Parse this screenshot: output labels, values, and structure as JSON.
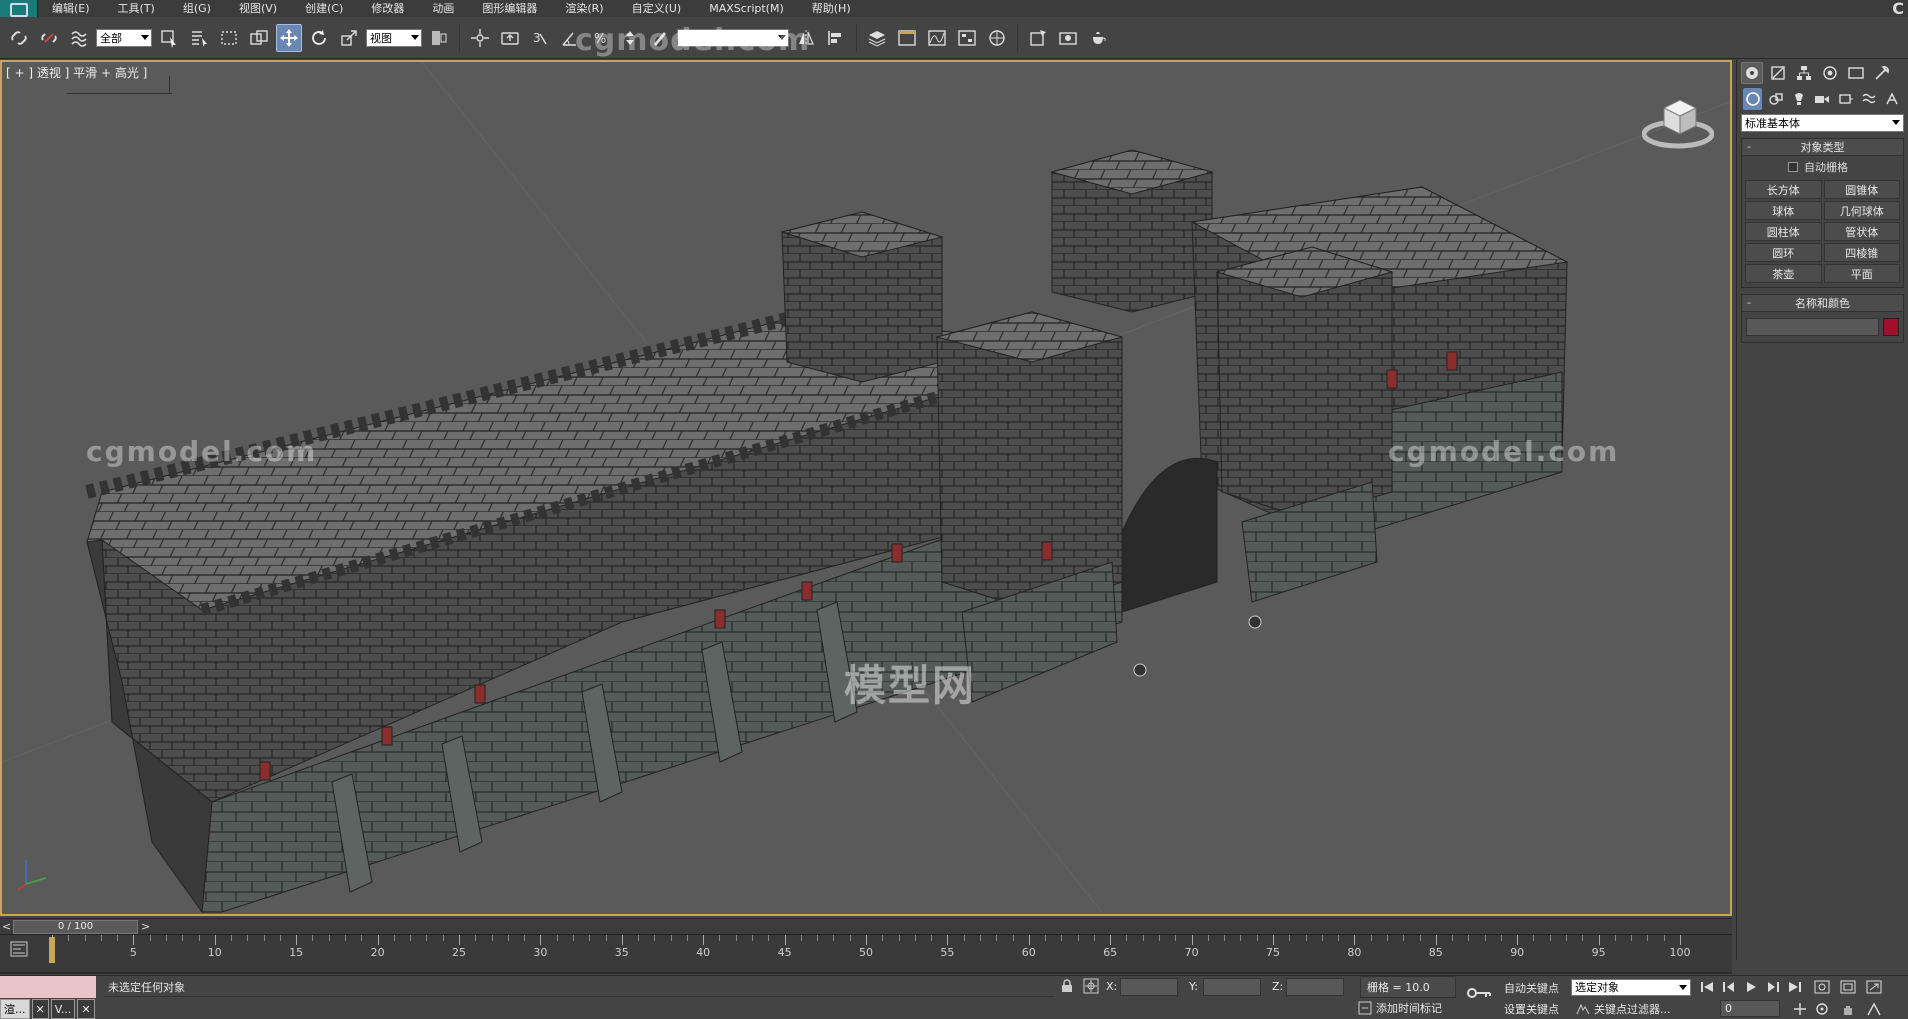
{
  "menubar": {
    "items": [
      "编辑(E)",
      "工具(T)",
      "组(G)",
      "视图(V)",
      "创建(C)",
      "修改器",
      "动画",
      "图形编辑器",
      "渲染(R)",
      "自定义(U)",
      "MAXScript(M)",
      "帮助(H)"
    ],
    "right_logo": "C"
  },
  "toolbar": {
    "selection_filter": "全部",
    "reference_coord": "视图",
    "watermark": "cgmodel.com",
    "active_tool": "move-tool"
  },
  "viewport": {
    "label": "[ + ] 透视 ] 平滑 + 高光 ]",
    "watermark_left": "cgmodel.com",
    "watermark_right": "cgmodel.com",
    "watermark_center": "模型网",
    "border_color": "#c7a55a",
    "background": "#5a5a5a"
  },
  "command_panel": {
    "category_dropdown": "标准基本体",
    "rollout_object_type": {
      "title": "对象类型",
      "autogrid_label": "自动栅格",
      "autogrid_checked": false,
      "buttons": [
        "长方体",
        "圆锥体",
        "球体",
        "几何球体",
        "圆柱体",
        "管状体",
        "圆环",
        "四棱锥",
        "茶壶",
        "平面"
      ]
    },
    "rollout_name_color": {
      "title": "名称和颜色",
      "name_value": "",
      "color": "#a0102c"
    }
  },
  "time_slider": {
    "label": "0 / 100",
    "current_frame": 0,
    "total_frames": 100
  },
  "track_ruler": {
    "labels": [
      "0",
      "5",
      "10",
      "15",
      "20",
      "25",
      "30",
      "35",
      "40",
      "45",
      "50",
      "55",
      "60",
      "65",
      "70",
      "75",
      "80",
      "85",
      "90",
      "95",
      "100"
    ]
  },
  "status_bar": {
    "status_text": "未选定任何对象",
    "x_label": "X:",
    "y_label": "Y:",
    "z_label": "Z:",
    "grid_label": "栅格 = 10.0",
    "time_tag_label": "添加时间标记",
    "autokey_label": "自动关键点",
    "setkey_label": "设置关键点",
    "selection_set": "选定对象",
    "key_filters_label": "关键点过滤器...",
    "frame_value": "0",
    "task_items": [
      "渲...",
      "V..."
    ]
  }
}
